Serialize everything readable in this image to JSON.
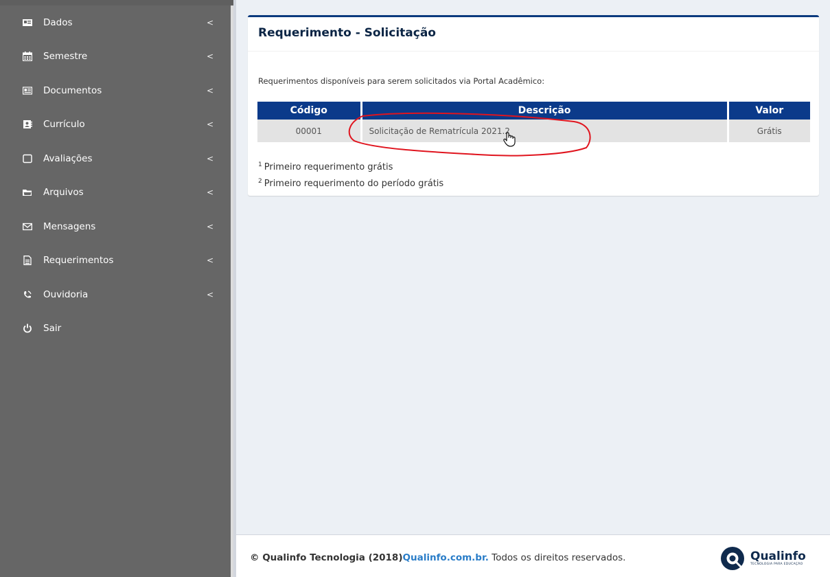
{
  "sidebar": {
    "items": [
      {
        "label": "Dados",
        "icon": "id-card-icon",
        "has_submenu": true
      },
      {
        "label": "Semestre",
        "icon": "calendar-icon",
        "has_submenu": true
      },
      {
        "label": "Documentos",
        "icon": "document-card-icon",
        "has_submenu": true
      },
      {
        "label": "Currículo",
        "icon": "address-book-icon",
        "has_submenu": true
      },
      {
        "label": "Avaliações",
        "icon": "square-outline-icon",
        "has_submenu": true
      },
      {
        "label": "Arquivos",
        "icon": "folder-open-icon",
        "has_submenu": true
      },
      {
        "label": "Mensagens",
        "icon": "envelope-icon",
        "has_submenu": true
      },
      {
        "label": "Requerimentos",
        "icon": "file-text-icon",
        "has_submenu": true
      },
      {
        "label": "Ouvidoria",
        "icon": "phone-volume-icon",
        "has_submenu": true
      },
      {
        "label": "Sair",
        "icon": "power-icon",
        "has_submenu": false
      }
    ],
    "chevron": "<"
  },
  "box": {
    "title": "Requerimento - Solicitação",
    "intro": "Requerimentos disponíveis para serem solicitados via Portal Acadêmico:",
    "table": {
      "headers": [
        "Código",
        "Descrição",
        "Valor"
      ],
      "rows": [
        {
          "codigo": "00001",
          "descricao": "Solicitação de Rematrícula 2021.2",
          "valor": "Grátis"
        }
      ]
    },
    "notes": [
      {
        "marker": "1",
        "text": "Primeiro requerimento grátis"
      },
      {
        "marker": "2",
        "text": "Primeiro requerimento do período grátis"
      }
    ]
  },
  "footer": {
    "copyright": "© Qualinfo Tecnologia (2018)",
    "link": "Qualinfo.com.br.",
    "rights": " Todos os direitos reservados.",
    "logo_text": "Qualinfo",
    "logo_sub": "TECNOLOGIA PARA EDUCAÇÃO"
  },
  "colors": {
    "sidebar_bg": "#666666",
    "table_header": "#0b3a8a",
    "box_accent": "#0b3a7e",
    "link": "#2a7dc8",
    "annotation": "#e0141e"
  }
}
